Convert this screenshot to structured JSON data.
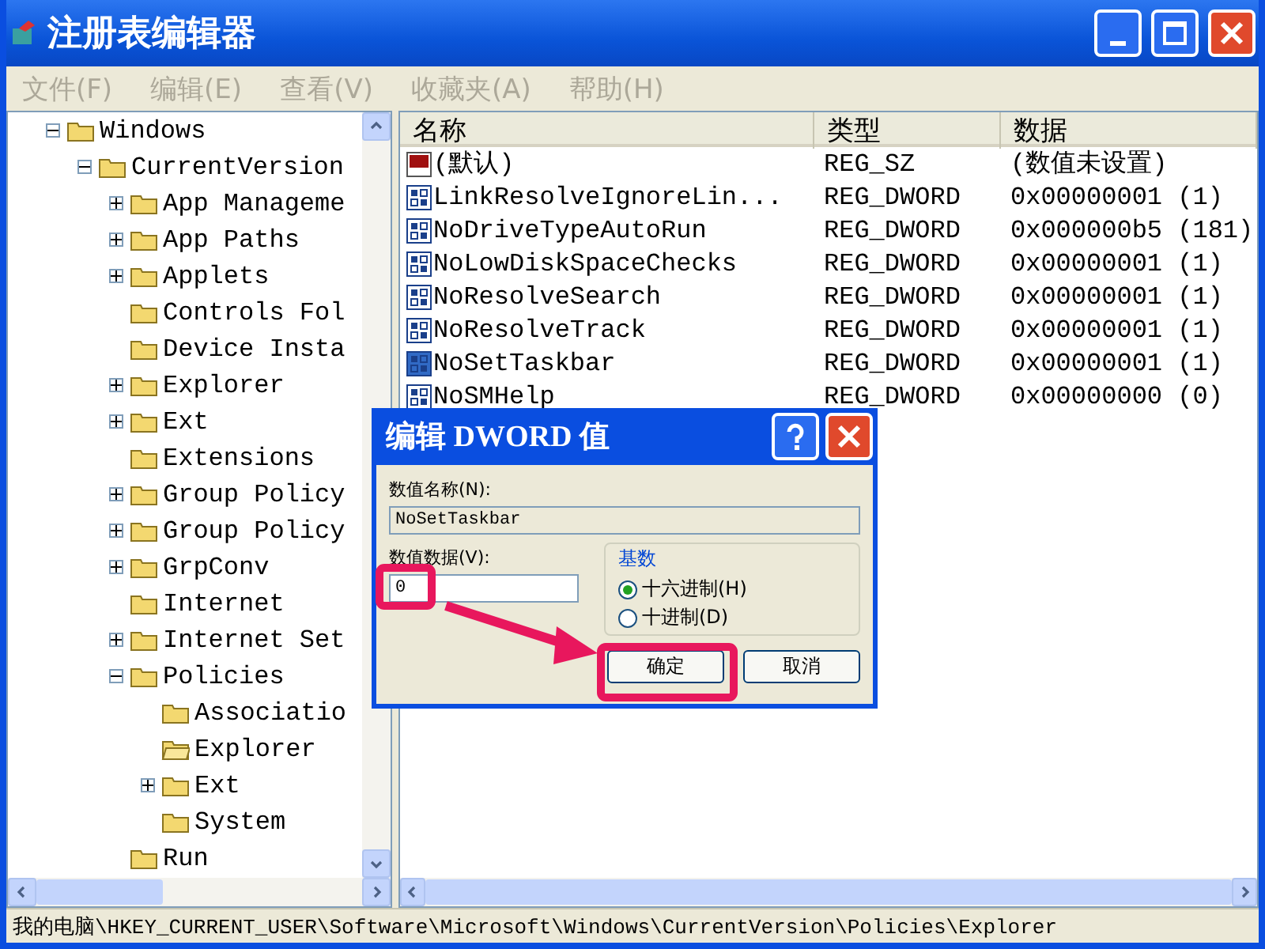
{
  "window": {
    "title": "注册表编辑器"
  },
  "menu": [
    {
      "label": "文件(F)",
      "disabled": true
    },
    {
      "label": "编辑(E)",
      "disabled": true
    },
    {
      "label": "查看(V)",
      "disabled": true
    },
    {
      "label": "收藏夹(A)",
      "disabled": true
    },
    {
      "label": "帮助(H)",
      "disabled": true
    }
  ],
  "tree": [
    {
      "label": "Windows",
      "kind": "expanded",
      "selected": false,
      "children": [
        {
          "label": "CurrentVersion",
          "kind": "expanded",
          "selected": false,
          "children": [
            {
              "label": "App Manageme",
              "kind": "collapsed",
              "selected": false
            },
            {
              "label": "App Paths",
              "kind": "collapsed",
              "selected": false
            },
            {
              "label": "Applets",
              "kind": "collapsed",
              "selected": false
            },
            {
              "label": "Controls Fol",
              "kind": "leaf",
              "selected": false
            },
            {
              "label": "Device Insta",
              "kind": "leaf",
              "selected": false
            },
            {
              "label": "Explorer",
              "kind": "collapsed",
              "selected": false
            },
            {
              "label": "Ext",
              "kind": "collapsed",
              "selected": false
            },
            {
              "label": "Extensions",
              "kind": "leaf",
              "selected": false
            },
            {
              "label": "Group Policy",
              "kind": "collapsed",
              "selected": false
            },
            {
              "label": "Group Policy",
              "kind": "collapsed",
              "selected": false
            },
            {
              "label": "GrpConv",
              "kind": "collapsed",
              "selected": false
            },
            {
              "label": "Internet",
              "kind": "leaf",
              "selected": false
            },
            {
              "label": "Internet Set",
              "kind": "collapsed",
              "selected": false
            },
            {
              "label": "Policies",
              "kind": "expanded",
              "selected": false,
              "children": [
                {
                  "label": "Associatio",
                  "kind": "leaf",
                  "selected": false
                },
                {
                  "label": "Explorer",
                  "kind": "leaf",
                  "selected": true
                },
                {
                  "label": "Ext",
                  "kind": "collapsed",
                  "selected": false
                },
                {
                  "label": "System",
                  "kind": "leaf",
                  "selected": false
                }
              ]
            },
            {
              "label": "Run",
              "kind": "leaf",
              "selected": false
            }
          ]
        }
      ]
    }
  ],
  "table": {
    "columns": [
      "名称",
      "类型",
      "数据"
    ],
    "rows": [
      {
        "kind": "string",
        "name": "(默认)",
        "type": "REG_SZ",
        "data": "(数值未设置)",
        "selected": false
      },
      {
        "kind": "dword",
        "name": "LinkResolveIgnoreLin...",
        "type": "REG_DWORD",
        "data": "0x00000001 (1)",
        "selected": false
      },
      {
        "kind": "dword",
        "name": "NoDriveTypeAutoRun",
        "type": "REG_DWORD",
        "data": "0x000000b5 (181)",
        "selected": false
      },
      {
        "kind": "dword",
        "name": "NoLowDiskSpaceChecks",
        "type": "REG_DWORD",
        "data": "0x00000001 (1)",
        "selected": false
      },
      {
        "kind": "dword",
        "name": "NoResolveSearch",
        "type": "REG_DWORD",
        "data": "0x00000001 (1)",
        "selected": false
      },
      {
        "kind": "dword",
        "name": "NoResolveTrack",
        "type": "REG_DWORD",
        "data": "0x00000001 (1)",
        "selected": false
      },
      {
        "kind": "dword",
        "name": "NoSetTaskbar",
        "type": "REG_DWORD",
        "data": "0x00000001 (1)",
        "selected": true
      },
      {
        "kind": "dword",
        "name": "NoSMHelp",
        "type": "REG_DWORD",
        "data": "0x00000000 (0)",
        "selected": false
      }
    ]
  },
  "dialog": {
    "title": "编辑 DWORD 值",
    "name_label": "数值名称(N):",
    "name_value": "NoSetTaskbar",
    "data_label": "数值数据(V):",
    "data_value": "0",
    "base_label": "基数",
    "radios": [
      {
        "label": "十六进制(H)",
        "selected": true
      },
      {
        "label": "十进制(D)",
        "selected": false
      }
    ],
    "buttons": [
      "确定",
      "取消"
    ]
  },
  "status_bar": "我的电脑\\HKEY_CURRENT_USER\\Software\\Microsoft\\Windows\\CurrentVersion\\Policies\\Explorer"
}
